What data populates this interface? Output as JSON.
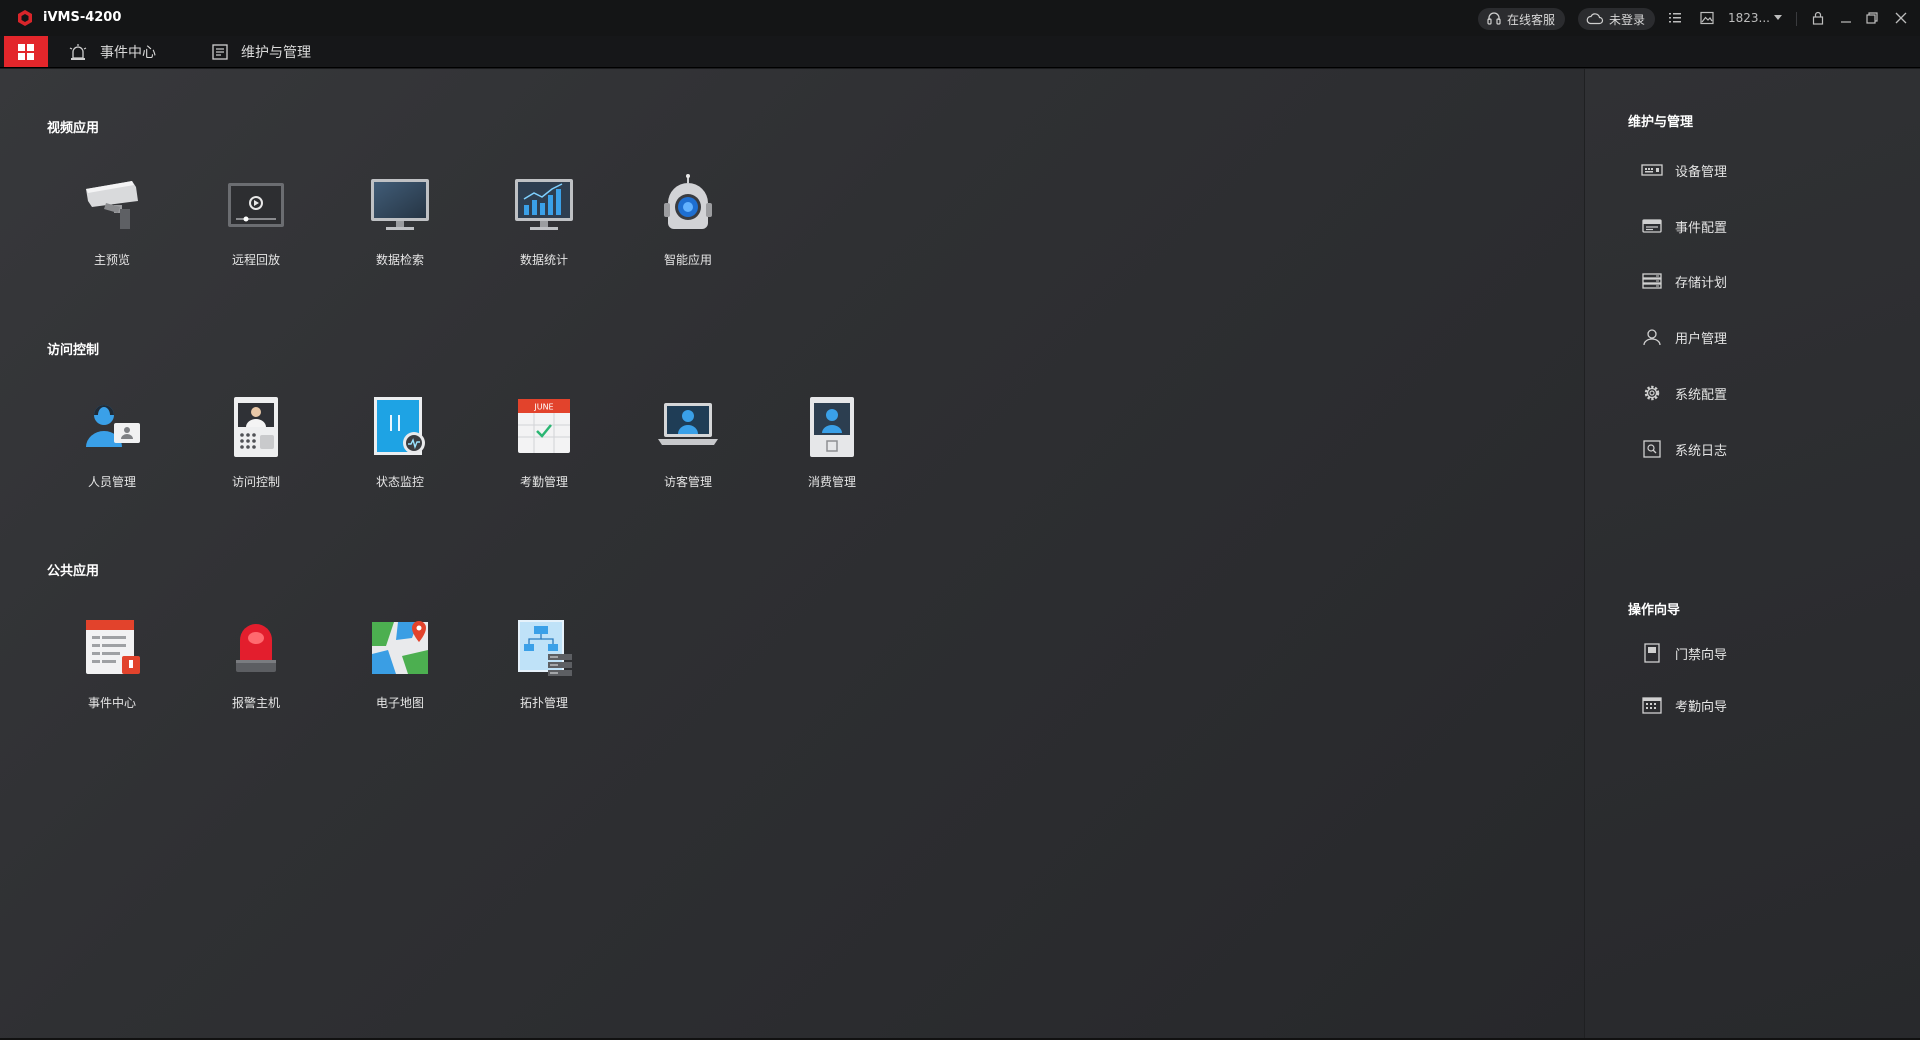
{
  "app": {
    "title": "iVMS-4200",
    "brand_color": "#e3262b"
  },
  "titlebar": {
    "online_service": "在线客服",
    "login_status": "未登录",
    "user": "1823...",
    "icons": [
      "headset-icon",
      "cloud-icon",
      "list-icon",
      "image-icon",
      "chevron-down-icon",
      "lock-icon",
      "minimize-icon",
      "restore-icon",
      "close-icon"
    ]
  },
  "menubar": {
    "home_icon": "grid-icon",
    "items": [
      {
        "label": "事件中心",
        "icon": "alarm-icon"
      },
      {
        "label": "维护与管理",
        "icon": "maintenance-icon"
      }
    ]
  },
  "sections": [
    {
      "title": "视频应用",
      "tiles": [
        {
          "label": "主预览",
          "icon": "camera-icon"
        },
        {
          "label": "远程回放",
          "icon": "playback-icon"
        },
        {
          "label": "数据检索",
          "icon": "monitor-icon"
        },
        {
          "label": "数据统计",
          "icon": "statistics-icon"
        },
        {
          "label": "智能应用",
          "icon": "robot-icon"
        }
      ]
    },
    {
      "title": "访问控制",
      "tiles": [
        {
          "label": "人员管理",
          "icon": "person-card-icon"
        },
        {
          "label": "访问控制",
          "icon": "access-terminal-icon"
        },
        {
          "label": "状态监控",
          "icon": "door-status-icon"
        },
        {
          "label": "考勤管理",
          "icon": "calendar-icon"
        },
        {
          "label": "访客管理",
          "icon": "visitor-laptop-icon"
        },
        {
          "label": "消费管理",
          "icon": "consumption-terminal-icon"
        }
      ]
    },
    {
      "title": "公共应用",
      "tiles": [
        {
          "label": "事件中心",
          "icon": "event-list-icon"
        },
        {
          "label": "报警主机",
          "icon": "siren-icon"
        },
        {
          "label": "电子地图",
          "icon": "map-icon"
        },
        {
          "label": "拓扑管理",
          "icon": "topology-icon"
        }
      ]
    }
  ],
  "sidebar": {
    "manage_title": "维护与管理",
    "manage_items": [
      {
        "label": "设备管理",
        "icon": "device-icon"
      },
      {
        "label": "事件配置",
        "icon": "event-config-icon"
      },
      {
        "label": "存储计划",
        "icon": "storage-icon"
      },
      {
        "label": "用户管理",
        "icon": "user-icon"
      },
      {
        "label": "系统配置",
        "icon": "gear-icon"
      },
      {
        "label": "系统日志",
        "icon": "log-icon"
      }
    ],
    "guide_title": "操作向导",
    "guide_items": [
      {
        "label": "门禁向导",
        "icon": "door-guide-icon"
      },
      {
        "label": "考勤向导",
        "icon": "attendance-guide-icon"
      }
    ]
  }
}
